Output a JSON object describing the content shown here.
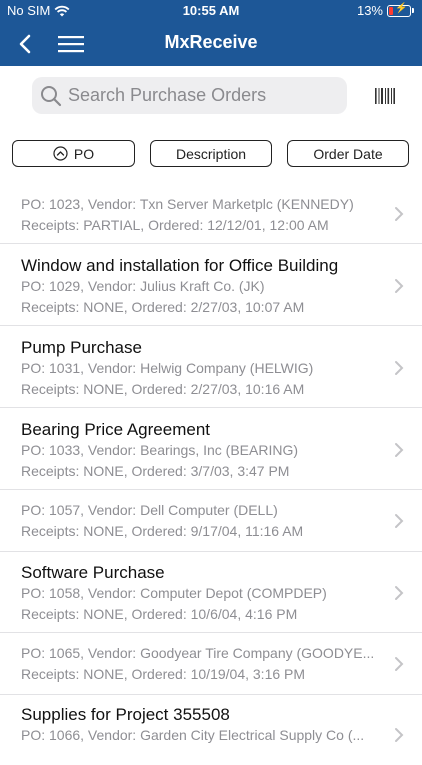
{
  "status_bar": {
    "carrier": "No SIM",
    "time": "10:55 AM",
    "battery": "13%"
  },
  "nav": {
    "title": "MxReceive"
  },
  "search": {
    "placeholder": "Search Purchase Orders"
  },
  "sort_buttons": [
    {
      "label": "PO",
      "icon": "chevron-up-circle-icon"
    },
    {
      "label": "Description"
    },
    {
      "label": "Order Date"
    }
  ],
  "orders": [
    {
      "title": "",
      "line1": "PO: 1023, Vendor: Txn Server Marketplc (KENNEDY)",
      "line2": "Receipts: PARTIAL, Ordered: 12/12/01, 12:00 AM"
    },
    {
      "title": "Window and installation for Office Building",
      "line1": "PO: 1029, Vendor: Julius Kraft Co. (JK)",
      "line2": "Receipts: NONE, Ordered: 2/27/03, 10:07 AM"
    },
    {
      "title": "Pump Purchase",
      "line1": "PO: 1031, Vendor: Helwig Company (HELWIG)",
      "line2": "Receipts: NONE, Ordered: 2/27/03, 10:16 AM"
    },
    {
      "title": "Bearing Price Agreement",
      "line1": "PO: 1033, Vendor: Bearings, Inc (BEARING)",
      "line2": "Receipts: NONE, Ordered: 3/7/03, 3:47 PM"
    },
    {
      "title": "",
      "line1": "PO: 1057, Vendor: Dell Computer (DELL)",
      "line2": "Receipts: NONE, Ordered: 9/17/04, 11:16 AM"
    },
    {
      "title": "Software Purchase",
      "line1": "PO: 1058, Vendor: Computer Depot (COMPDEP)",
      "line2": "Receipts: NONE, Ordered: 10/6/04, 4:16 PM"
    },
    {
      "title": "",
      "line1": "PO: 1065, Vendor: Goodyear Tire Company (GOODYE...",
      "line2": "Receipts: NONE, Ordered: 10/19/04, 3:16 PM"
    },
    {
      "title": "Supplies for Project 355508",
      "line1": "PO: 1066, Vendor: Garden City Electrical Supply Co (...",
      "line2": ""
    }
  ],
  "colors": {
    "nav_bar": "#1d5797",
    "subtitle_text": "#8e8e93",
    "separator": "#e2e2e5"
  }
}
